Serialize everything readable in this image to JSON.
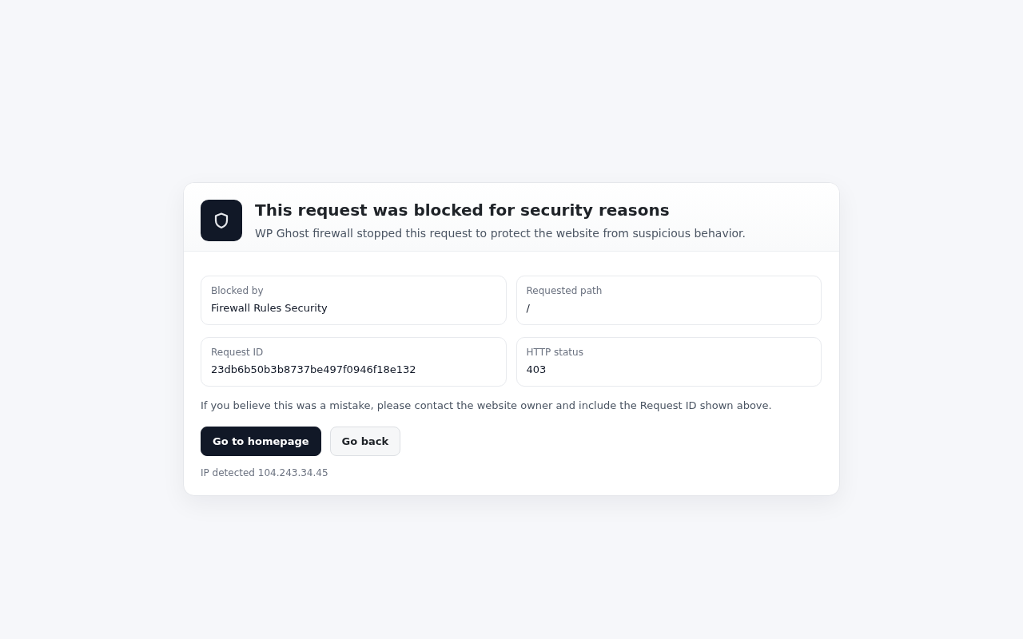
{
  "header": {
    "title": "This request was blocked for security reasons",
    "subtitle": "WP Ghost firewall stopped this request to protect the website from suspicious behavior."
  },
  "details": [
    {
      "label": "Blocked by",
      "value": "Firewall Rules Security"
    },
    {
      "label": "Requested path",
      "value": "/"
    },
    {
      "label": "Request ID",
      "value": "23db6b50b3b8737be497f0946f18e132"
    },
    {
      "label": "HTTP status",
      "value": "403"
    }
  ],
  "note": "If you believe this was a mistake, please contact the website owner and include the Request ID shown above.",
  "buttons": [
    {
      "label": "Go to homepage",
      "kind": "primary"
    },
    {
      "label": "Go back",
      "kind": "secondary"
    }
  ],
  "footer": "IP detected 104.243.34.45"
}
